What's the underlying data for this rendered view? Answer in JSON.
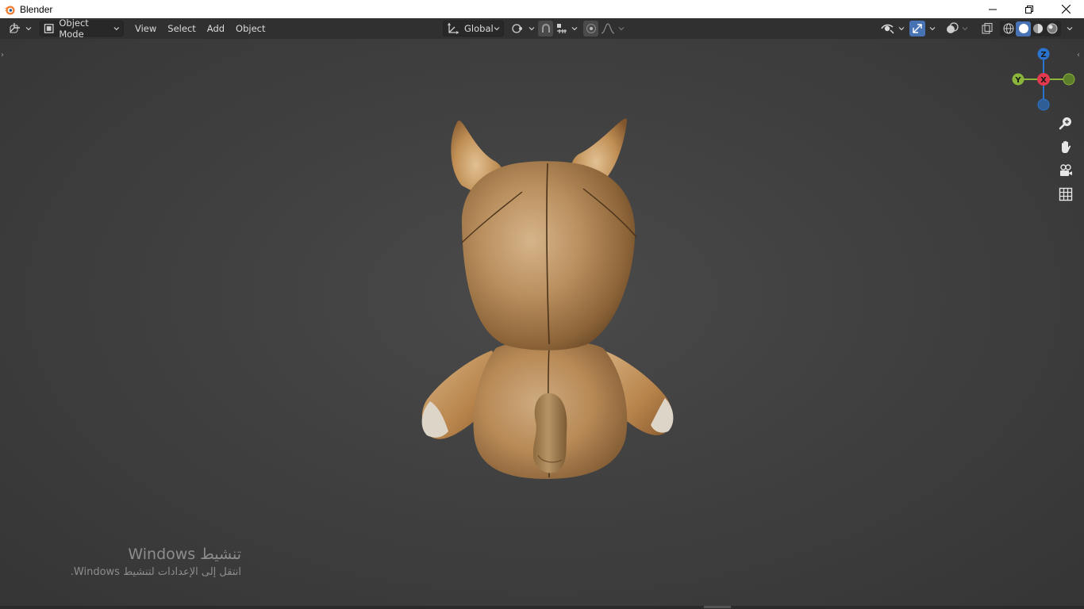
{
  "window": {
    "title": "Blender"
  },
  "header": {
    "mode_label": "Object Mode",
    "menus": [
      "View",
      "Select",
      "Add",
      "Object"
    ],
    "transform_orientation": "Global"
  },
  "gizmo": {
    "z_label": "Z",
    "y_label": "Y",
    "x_label": "X"
  },
  "viewport": {
    "object": "textured-cat-figure-back-view"
  },
  "activation_watermark": {
    "title": "تنشيط Windows",
    "subtitle": "انتقل إلى الإعدادات لتنشيط Windows."
  },
  "colors": {
    "background": "#3d3d3d",
    "header": "#303030",
    "accent_blue": "#4772b3",
    "axis_x": "#e2394f",
    "axis_y": "#8bb53a",
    "axis_z": "#2a74cf"
  }
}
